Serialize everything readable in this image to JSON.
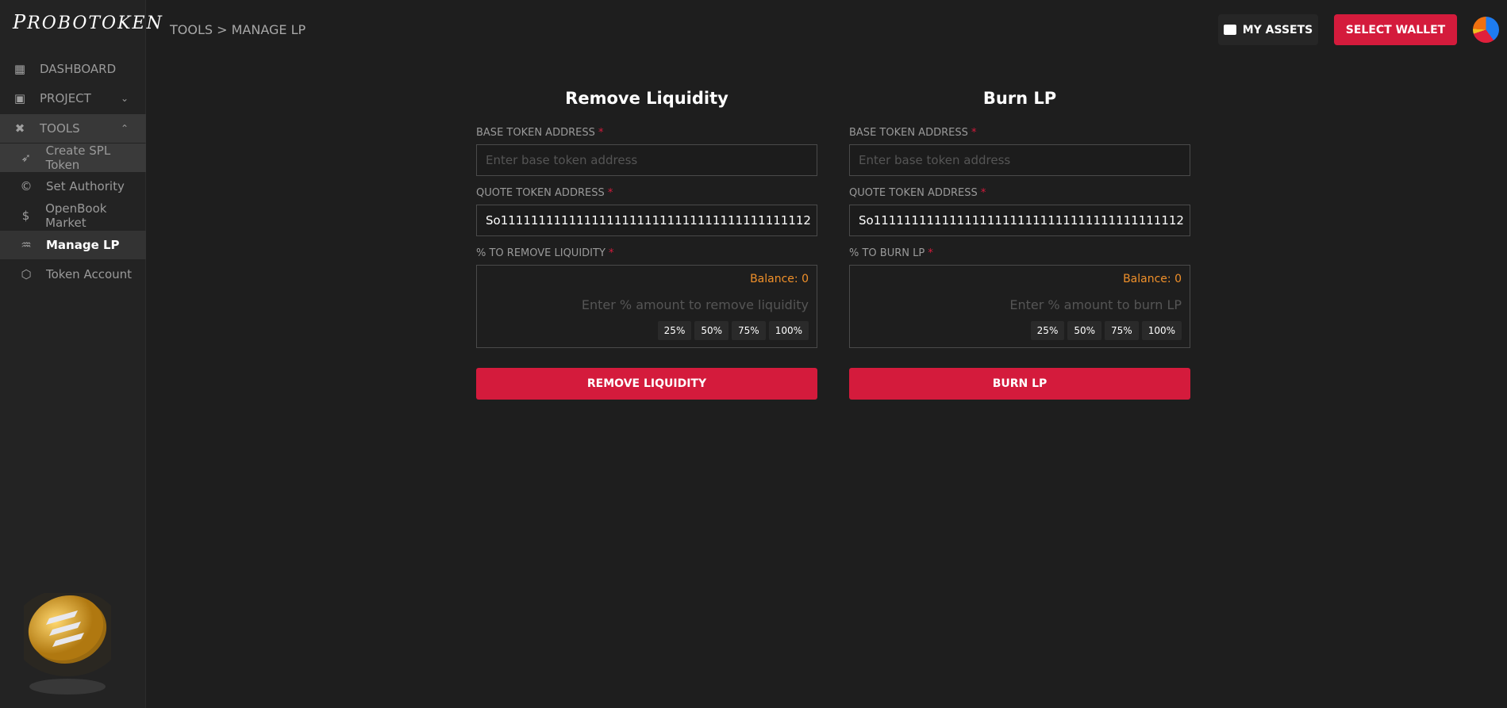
{
  "brand": {
    "logo": "PROBOTOKEN"
  },
  "breadcrumb": "TOOLS > MANAGE LP",
  "header": {
    "my_assets": "MY ASSETS",
    "select_wallet": "SELECT WALLET"
  },
  "sidebar": {
    "items": [
      {
        "label": "DASHBOARD",
        "icon": "dashboard-icon"
      },
      {
        "label": "PROJECT",
        "icon": "project-icon"
      },
      {
        "label": "TOOLS",
        "icon": "tools-icon"
      },
      {
        "label": "Create SPL Token",
        "icon": "rocket-icon"
      },
      {
        "label": "Set Authority",
        "icon": "copyright-icon"
      },
      {
        "label": "OpenBook Market",
        "icon": "market-icon"
      },
      {
        "label": "Manage LP",
        "icon": "pool-icon"
      },
      {
        "label": "Token Account",
        "icon": "cube-icon"
      }
    ]
  },
  "remove": {
    "title": "Remove Liquidity",
    "base_label": "BASE TOKEN ADDRESS",
    "base_placeholder": "Enter base token address",
    "quote_label": "QUOTE TOKEN ADDRESS",
    "quote_value": "So11111111111111111111111111111111111111112",
    "pct_label": "% TO REMOVE LIQUIDITY",
    "balance": "Balance: 0",
    "pct_placeholder": "Enter % amount to remove liquidity",
    "presets": [
      "25%",
      "50%",
      "75%",
      "100%"
    ],
    "button": "REMOVE LIQUIDITY"
  },
  "burn": {
    "title": "Burn LP",
    "base_label": "BASE TOKEN ADDRESS",
    "base_placeholder": "Enter base token address",
    "quote_label": "QUOTE TOKEN ADDRESS",
    "quote_value": "So11111111111111111111111111111111111111112",
    "pct_label": "% TO BURN LP",
    "balance": "Balance: 0",
    "pct_placeholder": "Enter % amount to burn LP",
    "presets": [
      "25%",
      "50%",
      "75%",
      "100%"
    ],
    "button": "BURN LP"
  },
  "required_mark": "*",
  "colors": {
    "accent": "#d41b3c",
    "balance": "#f0902a",
    "background": "#1e1e1e"
  }
}
